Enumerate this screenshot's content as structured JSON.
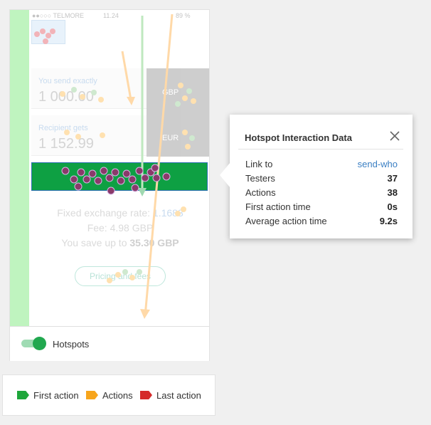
{
  "phone": {
    "status_carrier": "●●○○○ TELMORE",
    "status_time": "11.24",
    "status_battery": "89 %",
    "send_label": "You send exactly",
    "send_amount": "1 000.00",
    "recipient_label": "Recipient gets",
    "recipient_amount": "1 152.99",
    "currency_send": "GBP",
    "currency_receive": "EUR",
    "rate_text": "Fixed exchange rate: ",
    "rate_value": "1.1683",
    "fee_text": "Fee: 4.98 GBP",
    "save_text": "You save up to ",
    "save_value": "35.30 GBP",
    "pricing_button": "Pricing and fees"
  },
  "toggle": {
    "label": "Hotspots",
    "on": true
  },
  "legend": {
    "items": [
      {
        "label": "First action",
        "color": "#1ea63b"
      },
      {
        "label": "Actions",
        "color": "#f7a51c"
      },
      {
        "label": "Last action",
        "color": "#d52a2a"
      }
    ]
  },
  "popover": {
    "title": "Hotspot Interaction Data",
    "link_label": "Link to",
    "link_value": "send-who",
    "testers_label": "Testers",
    "testers_value": "37",
    "actions_label": "Actions",
    "actions_value": "38",
    "first_label": "First action time",
    "first_value": "0s",
    "avg_label": "Average action time",
    "avg_value": "9.2s"
  },
  "colors": {
    "hotspot_green": "#0ea043",
    "tap_dot": "#8a3a6a",
    "swipe_orange": "#ffd9a8"
  }
}
